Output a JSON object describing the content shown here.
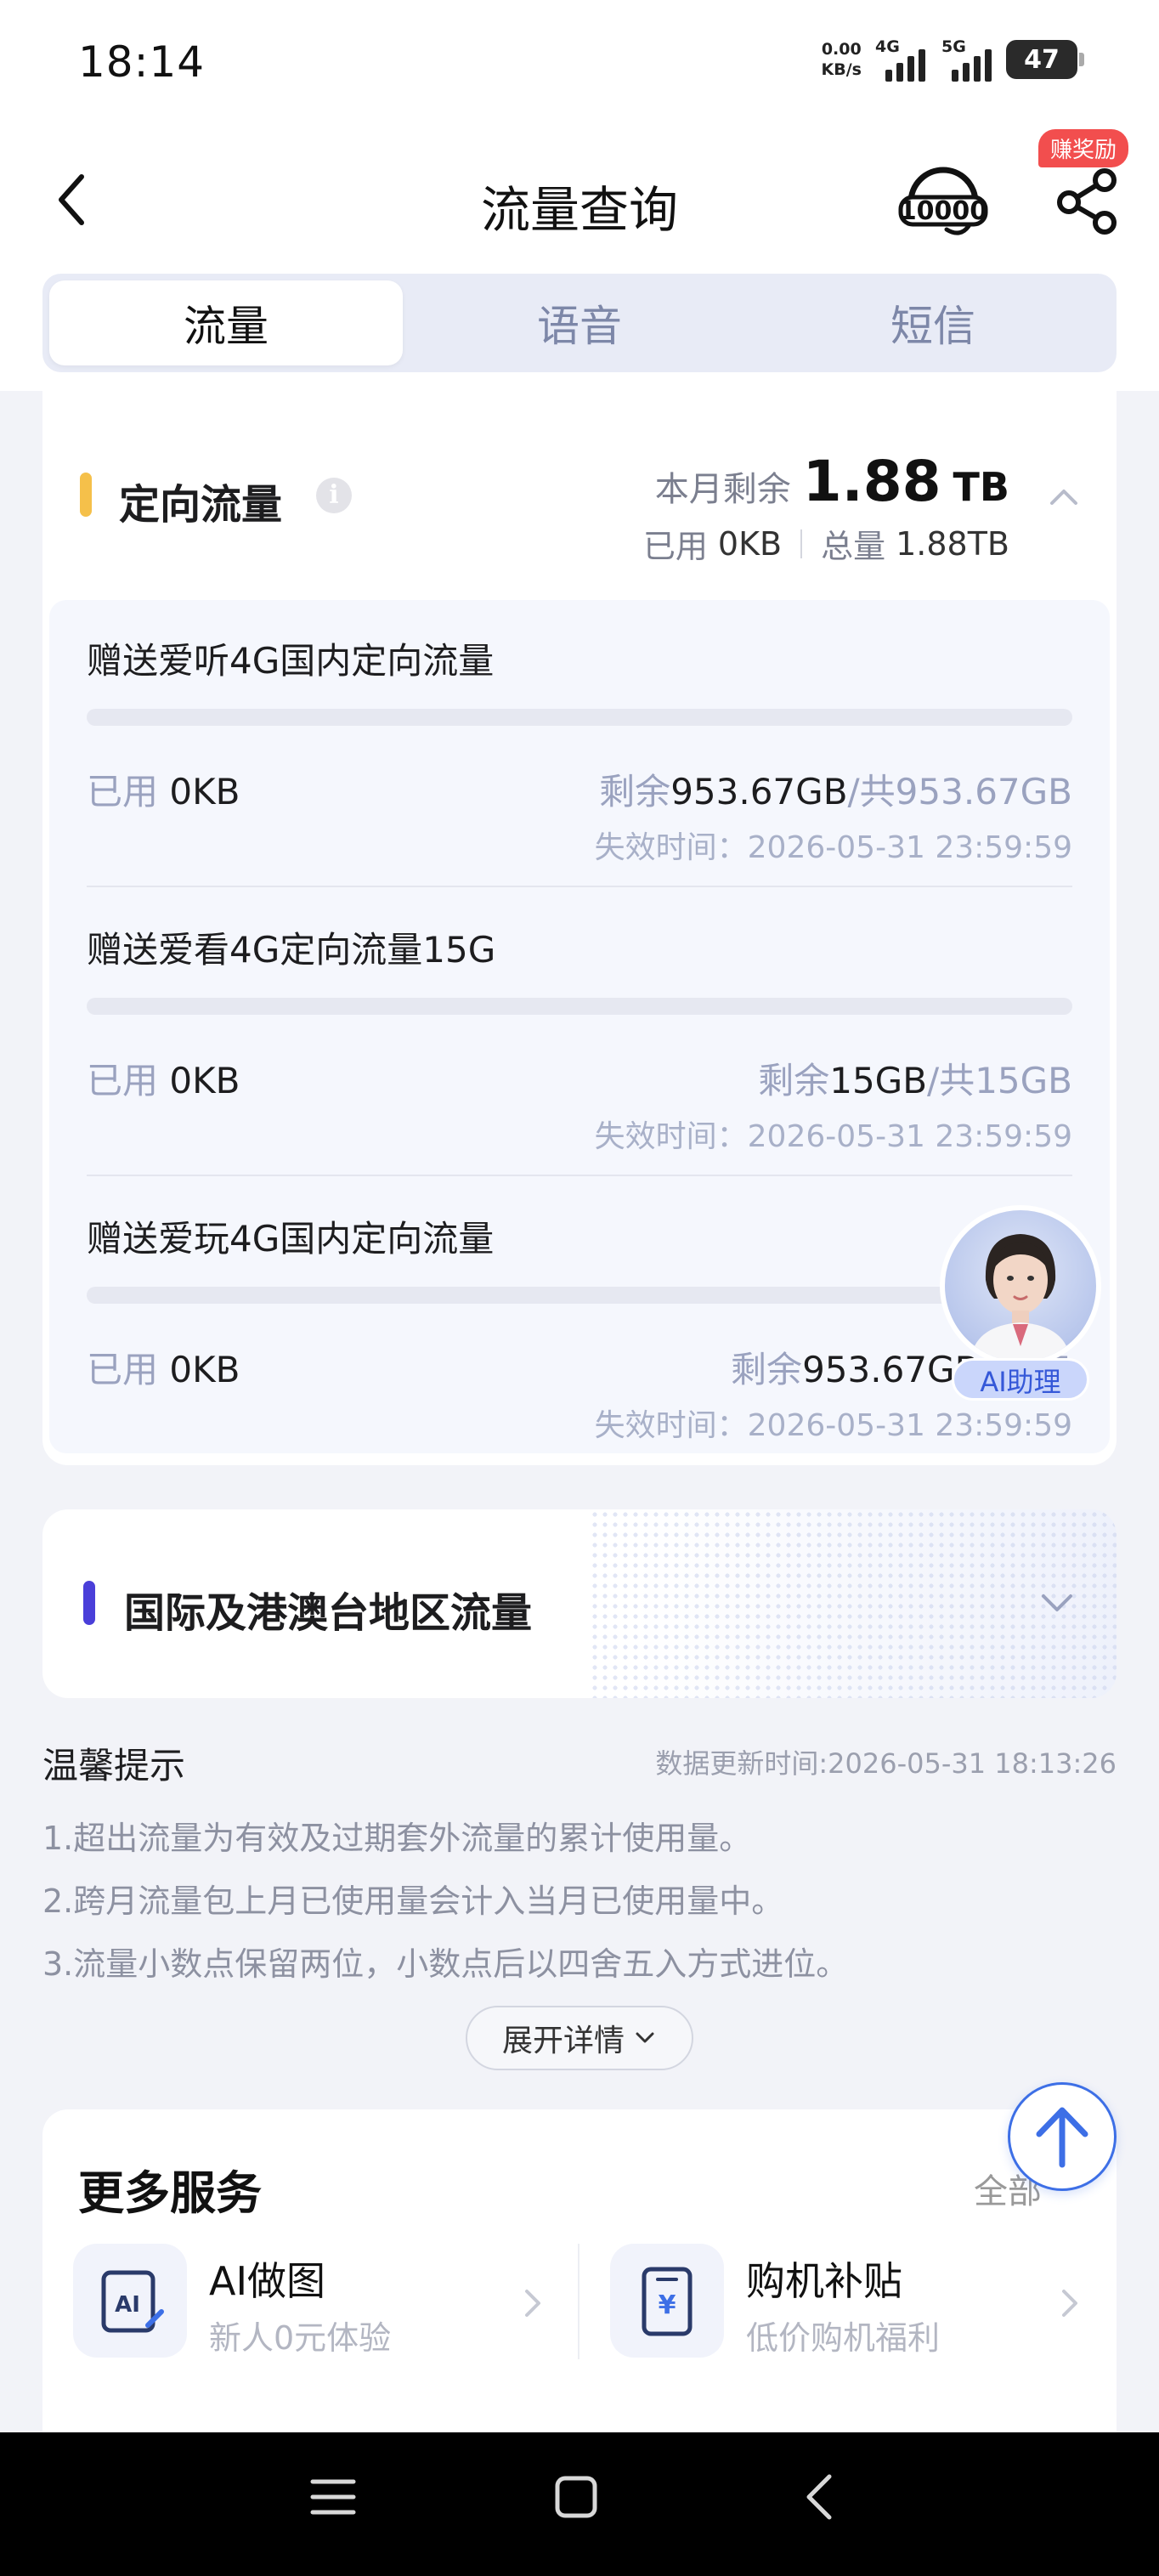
{
  "status_bar": {
    "time": "18:14",
    "net_speed_value": "0.00",
    "net_speed_unit": "KB/s",
    "sim1_type": "4G",
    "sim2_type": "5G",
    "battery": "47"
  },
  "header": {
    "title": "流量查询",
    "hotline_icon": "10000-customer-service-icon",
    "share_icon": "share-icon",
    "reward_badge": "赚奖励"
  },
  "tabs": [
    {
      "label": "流量",
      "active": true
    },
    {
      "label": "语音",
      "active": false
    },
    {
      "label": "短信",
      "active": false
    }
  ],
  "directed_flow": {
    "title": "定向流量",
    "accent_color": "#f5c04a",
    "remain_label": "本月剩余",
    "remain_value": "1.88",
    "remain_unit": "TB",
    "used_label": "已用",
    "used_value": "0KB",
    "total_label": "总量",
    "total_value": "1.88TB",
    "packages": [
      {
        "name": "赠送爱听4G国内定向流量",
        "used_fraction": 0,
        "used_label": "已用",
        "used": "0KB",
        "remain_label": "剩余",
        "remain": "953.67GB",
        "total_label": "/共",
        "total": "953.67GB",
        "expire": "失效时间：2026-05-31 23:59:59"
      },
      {
        "name": "赠送爱看4G定向流量15G",
        "used_fraction": 0,
        "used_label": "已用",
        "used": "0KB",
        "remain_label": "剩余",
        "remain": "15GB",
        "total_label": "/共",
        "total": "15GB",
        "expire": "失效时间：2026-05-31 23:59:59"
      },
      {
        "name": "赠送爱玩4G国内定向流量",
        "used_fraction": 0,
        "used_label": "已用",
        "used": "0KB",
        "remain_label": "剩余",
        "remain": "953.67GB",
        "total_label": "/共",
        "total": "95",
        "expire": "失效时间：2026-05-31 23:59:59"
      }
    ]
  },
  "ai_assistant": {
    "label": "AI助理"
  },
  "international": {
    "title": "国际及港澳台地区流量",
    "accent_color": "#4a3fd9"
  },
  "tips": {
    "title": "温馨提示",
    "update_time": "数据更新时间:2026-05-31 18:13:26",
    "lines": [
      "1.超出流量为有效及过期套外流量的累计使用量。",
      "2.跨月流量包上月已使用量会计入当月已使用量中。",
      "3.流量小数点保留两位，小数点后以四舍五入方式进位。"
    ],
    "expand_label": "展开详情"
  },
  "more_services": {
    "title": "更多服务",
    "all_label": "全部",
    "items": [
      {
        "name": "AI做图",
        "desc": "新人0元体验",
        "icon": "ai-image-icon"
      },
      {
        "name": "购机补贴",
        "desc": "低价购机福利",
        "icon": "phone-subsidy-icon"
      }
    ]
  }
}
